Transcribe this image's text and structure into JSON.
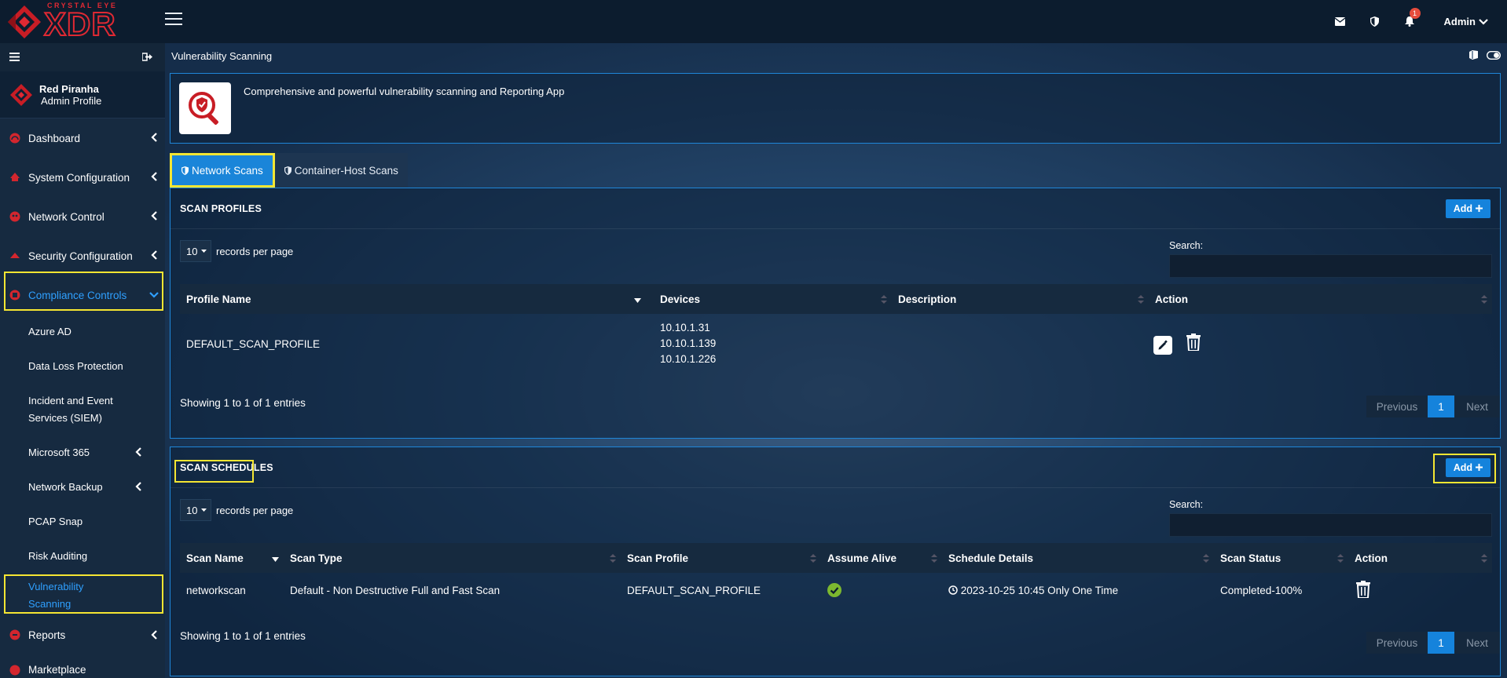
{
  "topbar": {
    "brand_small": "CRYSTAL EYE",
    "brand_big": "XDR",
    "notification_count": "1",
    "user_label": "Admin"
  },
  "sidebar": {
    "profile_name": "Red Piranha",
    "profile_role": "Admin Profile",
    "items": [
      {
        "label": "Dashboard"
      },
      {
        "label": "System Configuration"
      },
      {
        "label": "Network Control"
      },
      {
        "label": "Security Configuration"
      },
      {
        "label": "Compliance Controls"
      }
    ],
    "subitems": [
      {
        "label": "Azure AD"
      },
      {
        "label": "Data Loss Protection"
      },
      {
        "label": "Incident and Event Services (SIEM)"
      },
      {
        "label": "Microsoft 365"
      },
      {
        "label": "Network Backup"
      },
      {
        "label": "PCAP Snap"
      },
      {
        "label": "Risk Auditing"
      },
      {
        "label": "Vulnerability Scanning"
      }
    ],
    "bottom_items": [
      {
        "label": "Reports"
      },
      {
        "label": "Marketplace"
      }
    ]
  },
  "main": {
    "page_title": "Vulnerability Scanning",
    "app_description": "Comprehensive and powerful vulnerability scanning and Reporting App",
    "tabs": [
      {
        "label": "Network Scans"
      },
      {
        "label": "Container-Host Scans"
      }
    ]
  },
  "profiles": {
    "title": "SCAN PROFILES",
    "add_label": "Add",
    "rpp_value": "10",
    "rpp_label": "records per page",
    "search_label": "Search:",
    "columns": [
      "Profile Name",
      "Devices",
      "Description",
      "Action"
    ],
    "rows": [
      {
        "name": "DEFAULT_SCAN_PROFILE",
        "devices": [
          "10.10.1.31",
          "10.10.1.139",
          "10.10.1.226"
        ],
        "description": ""
      }
    ],
    "showing": "Showing 1 to 1 of 1 entries",
    "pager": {
      "prev": "Previous",
      "page": "1",
      "next": "Next"
    }
  },
  "schedules": {
    "title": "SCAN SCHEDULES",
    "add_label": "Add",
    "rpp_value": "10",
    "rpp_label": "records per page",
    "search_label": "Search:",
    "columns": [
      "Scan Name",
      "Scan Type",
      "Scan Profile",
      "Assume Alive",
      "Schedule Details",
      "Scan Status",
      "Action"
    ],
    "rows": [
      {
        "name": "networkscan",
        "type": "Default - Non Destructive Full and Fast Scan",
        "profile": "DEFAULT_SCAN_PROFILE",
        "schedule": "2023-10-25 10:45 Only One Time",
        "status": "Completed-100%"
      }
    ],
    "showing": "Showing 1 to 1 of 1 entries",
    "pager": {
      "prev": "Previous",
      "page": "1",
      "next": "Next"
    }
  },
  "colors": {
    "accent_blue": "#1583dc",
    "brand_red": "#e02933",
    "highlight_yellow": "#f5e632",
    "success_green": "#7cb82f"
  }
}
